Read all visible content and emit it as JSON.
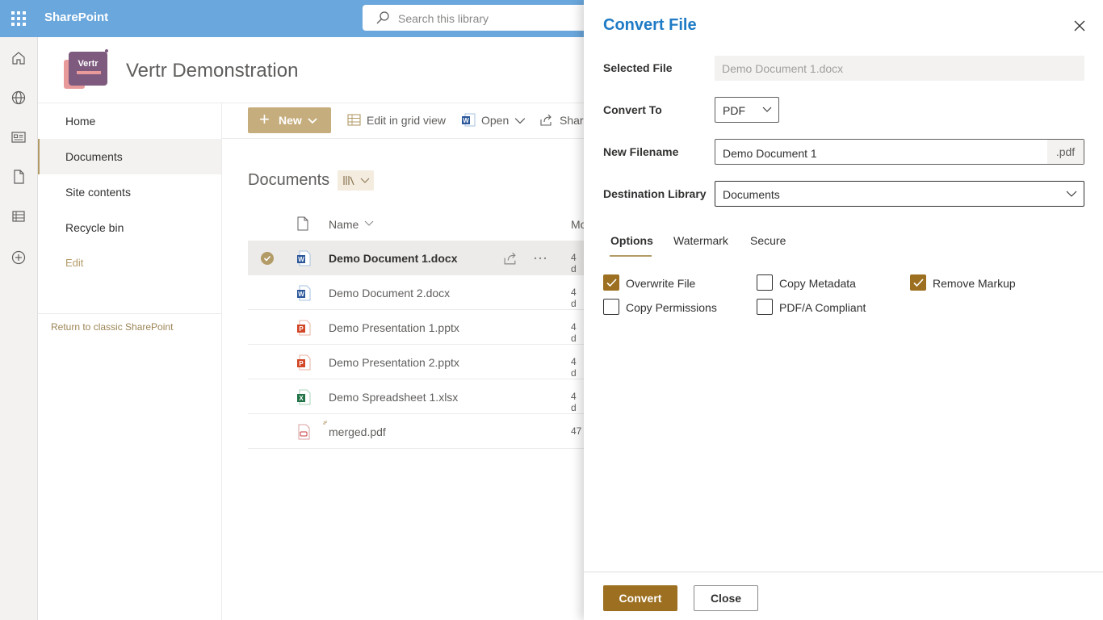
{
  "suite": {
    "brand": "SharePoint",
    "search_placeholder": "Search this library"
  },
  "rail": [
    "home-icon",
    "globe-icon",
    "news-icon",
    "file-icon",
    "list-icon",
    "add-icon"
  ],
  "site": {
    "logo_text": "Vertr",
    "title": "Vertr Demonstration"
  },
  "nav": {
    "items": [
      {
        "label": "Home"
      },
      {
        "label": "Documents"
      },
      {
        "label": "Site contents"
      },
      {
        "label": "Recycle bin"
      },
      {
        "label": "Edit"
      }
    ],
    "classic_link": "Return to classic SharePoint"
  },
  "commands": {
    "new_label": "New",
    "grid_label": "Edit in grid view",
    "open_label": "Open",
    "share_label": "Share"
  },
  "library": {
    "title": "Documents",
    "col_name": "Name",
    "col_modified": "Mo",
    "files": [
      {
        "name": "Demo Document 1.docx",
        "modified": "4 d",
        "type": "word"
      },
      {
        "name": "Demo Document 2.docx",
        "modified": "4 d",
        "type": "word"
      },
      {
        "name": "Demo Presentation 1.pptx",
        "modified": "4 d",
        "type": "ppt"
      },
      {
        "name": "Demo Presentation 2.pptx",
        "modified": "4 d",
        "type": "ppt"
      },
      {
        "name": "Demo Spreadsheet 1.xlsx",
        "modified": "4 d",
        "type": "excel"
      },
      {
        "name": "merged.pdf",
        "modified": "47",
        "type": "pdf"
      }
    ]
  },
  "panel": {
    "title": "Convert File",
    "selected_file_label": "Selected File",
    "selected_file_value": "Demo Document 1.docx",
    "convert_to_label": "Convert To",
    "convert_to_value": "PDF",
    "new_filename_label": "New Filename",
    "new_filename_value": "Demo Document 1",
    "new_filename_suffix": ".pdf",
    "destination_label": "Destination Library",
    "destination_value": "Documents",
    "tabs": [
      "Options",
      "Watermark",
      "Secure"
    ],
    "options": [
      {
        "label": "Overwrite File",
        "checked": true
      },
      {
        "label": "Copy Metadata",
        "checked": false
      },
      {
        "label": "Remove Markup",
        "checked": true
      },
      {
        "label": "Copy Permissions",
        "checked": false
      },
      {
        "label": "PDF/A Compliant",
        "checked": false
      }
    ],
    "convert_button": "Convert",
    "close_button": "Close"
  },
  "colors": {
    "suite_bar": "#6aa7dc",
    "accent": "#b39b68",
    "primary_button": "#9c7020",
    "panel_title": "#1f7bc5"
  }
}
